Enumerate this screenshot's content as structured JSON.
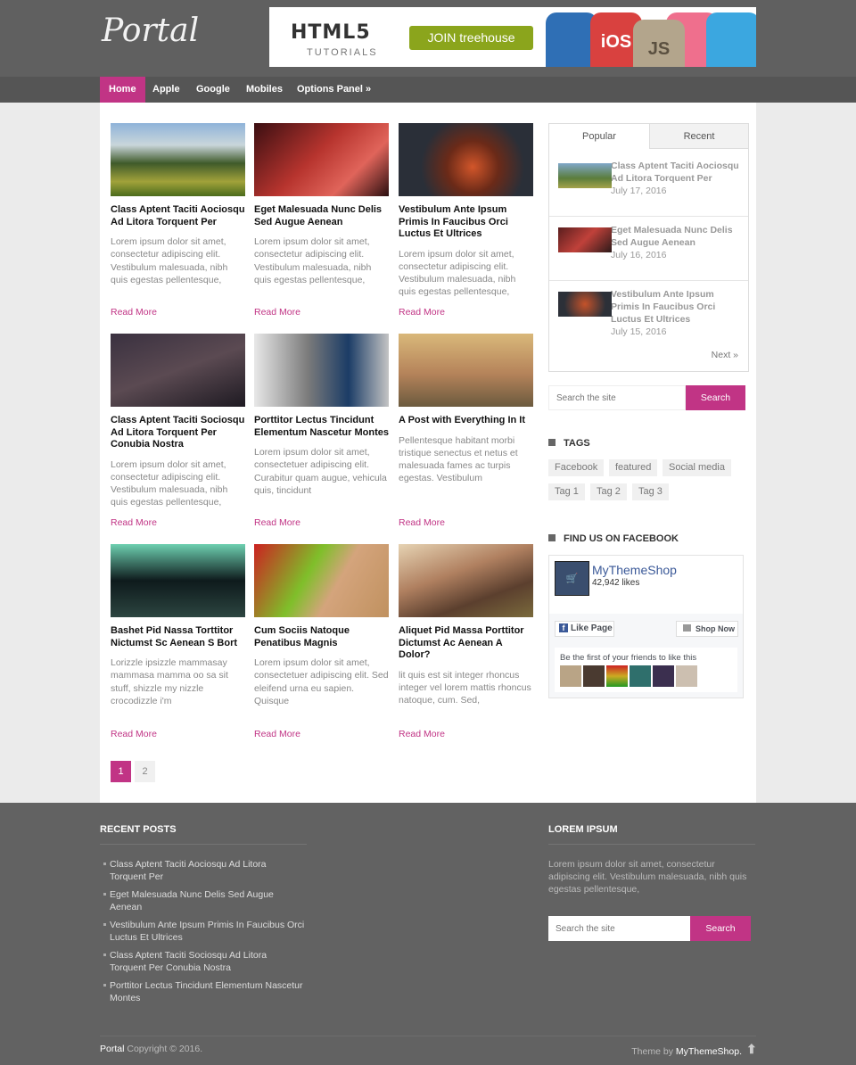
{
  "site": {
    "logo": "Portal"
  },
  "banner": {
    "title": "HTML5",
    "subtitle": "TUTORIALS",
    "cta": "JOIN treehouse",
    "badges": [
      "iOS",
      "JS"
    ]
  },
  "nav": {
    "items": [
      "Home",
      "Apple",
      "Google",
      "Mobiles",
      "Options Panel »"
    ],
    "active": "Home"
  },
  "posts": [
    {
      "title": "Class Aptent Taciti Aociosqu Ad Litora Torquent Per",
      "excerpt": "Lorem ipsum dolor sit amet, consectetur adipiscing elit. Vestibulum malesuada, nibh quis egestas pellentesque,",
      "read_more": "Read More"
    },
    {
      "title": "Eget Malesuada Nunc Delis Sed Augue Aenean",
      "excerpt": "Lorem ipsum dolor sit amet, consectetur adipiscing elit. Vestibulum malesuada, nibh quis egestas pellentesque,",
      "read_more": "Read More"
    },
    {
      "title": "Vestibulum Ante Ipsum Primis In Faucibus Orci Luctus Et Ultrices",
      "excerpt": "Lorem ipsum dolor sit amet, consectetur adipiscing elit. Vestibulum malesuada, nibh quis egestas pellentesque,",
      "read_more": "Read More"
    },
    {
      "title": "Class Aptent Taciti Sociosqu Ad Litora Torquent Per Conubia Nostra",
      "excerpt": "Lorem ipsum dolor sit amet, consectetur adipiscing elit. Vestibulum malesuada, nibh quis egestas pellentesque,",
      "read_more": "Read More"
    },
    {
      "title": "Porttitor Lectus Tincidunt Elementum Nascetur Montes",
      "excerpt": "Lorem ipsum dolor sit amet, consectetuer adipiscing elit. Curabitur quam augue, vehicula quis, tincidunt",
      "read_more": "Read More"
    },
    {
      "title": "A Post with Everything In It",
      "excerpt": "Pellentesque habitant morbi tristique senectus et netus et malesuada fames ac turpis egestas. Vestibulum",
      "read_more": "Read More"
    },
    {
      "title": "Bashet Pid Nassa Torttitor Nictumst Sc Aenean S Bort",
      "excerpt": "Lorizzle ipsizzle mammasay mammasa mamma oo sa sit stuff, shizzle my nizzle crocodizzle i'm",
      "read_more": "Read More"
    },
    {
      "title": "Cum Sociis Natoque Penatibus Magnis",
      "excerpt": "Lorem ipsum dolor sit amet, consectetuer adipiscing elit. Sed eleifend urna eu sapien. Quisque",
      "read_more": "Read More"
    },
    {
      "title": "Aliquet Pid Massa Porttitor Dictumst Ac Aenean A Dolor?",
      "excerpt": "lit quis est sit integer rhoncus integer vel lorem mattis rhoncus natoque, cum. Sed,",
      "read_more": "Read More"
    }
  ],
  "pagination": {
    "pages": [
      "1",
      "2"
    ],
    "current": "1"
  },
  "sidebar": {
    "tabs": [
      "Popular",
      "Recent"
    ],
    "active_tab": "Popular",
    "popular": [
      {
        "title": "Class Aptent Taciti Aociosqu Ad Litora Torquent Per",
        "date": "July 17, 2016"
      },
      {
        "title": "Eget Malesuada Nunc Delis Sed Augue Aenean",
        "date": "July 16, 2016"
      },
      {
        "title": "Vestibulum Ante Ipsum Primis In Faucibus Orci Luctus Et Ultrices",
        "date": "July 15, 2016"
      }
    ],
    "next": "Next »",
    "search": {
      "placeholder": "Search the site",
      "button": "Search"
    },
    "tags_title": "TAGS",
    "tags": [
      "Facebook",
      "featured",
      "Social media",
      "Tag 1",
      "Tag 2",
      "Tag 3"
    ],
    "facebook_title": "FIND US ON FACEBOOK",
    "facebook": {
      "page": "MyThemeShop",
      "likes": "42,942 likes",
      "like_button": "Like Page",
      "shop_button": "Shop Now",
      "friends_text": "Be the first of your friends to like this"
    }
  },
  "footer": {
    "recent_title": "RECENT POSTS",
    "recent": [
      "Class Aptent Taciti Aociosqu Ad Litora Torquent Per",
      "Eget Malesuada Nunc Delis Sed Augue Aenean",
      "Vestibulum Ante Ipsum Primis In Faucibus Orci Luctus Et Ultrices",
      "Class Aptent Taciti Sociosqu Ad Litora Torquent Per Conubia Nostra",
      "Porttitor Lectus Tincidunt Elementum Nascetur Montes"
    ],
    "lorem_title": "LOREM IPSUM",
    "lorem_text": "Lorem ipsum dolor sit amet, consectetur adipiscing elit. Vestibulum malesuada, nibh quis egestas pellentesque,",
    "search": {
      "placeholder": "Search the site",
      "button": "Search"
    },
    "copyright_brand": "Portal",
    "copyright": "Copyright © 2016.",
    "theme_by": "Theme by",
    "theme_link": "MyThemeShop."
  },
  "colors": {
    "accent": "#c13485",
    "header": "#606060",
    "nav": "#555555",
    "footer": "#626262"
  }
}
